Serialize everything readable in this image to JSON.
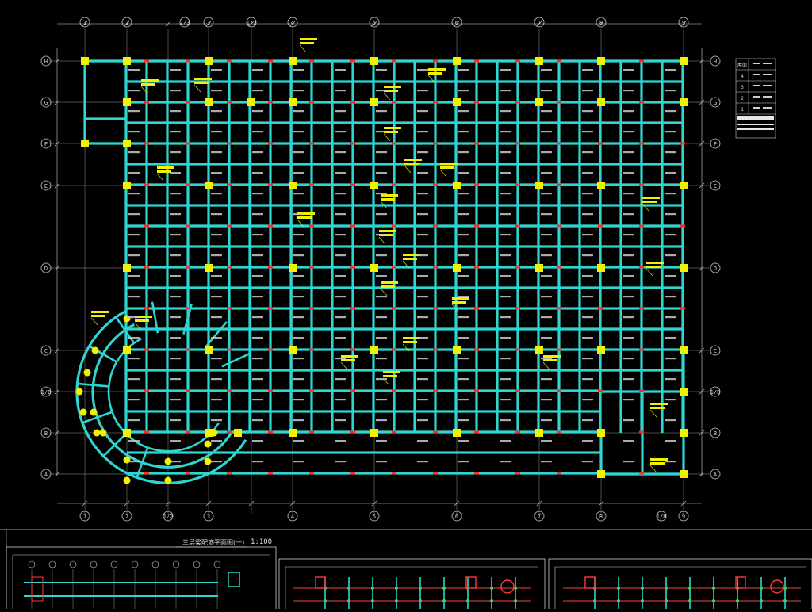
{
  "drawing": {
    "title": "三层梁配筋平面图(一)",
    "scale": "1:100",
    "colors": {
      "background": "#000000",
      "beam": "#2fd6d0",
      "column": "#f2f200",
      "axis_line": "#cfcfcf",
      "annotation": "#f2f200",
      "rebar_mark": "#ff2a2a",
      "text": "#d8d8d8"
    }
  },
  "axes": {
    "top_numbers": [
      "1",
      "2",
      "2/3",
      "3",
      "1/3",
      "4",
      "5",
      "6",
      "7",
      "8",
      "9"
    ],
    "bottom_numbers": [
      "1",
      "2",
      "1/2",
      "3",
      "4",
      "5",
      "6",
      "7",
      "8",
      "1/8",
      "9"
    ],
    "left_letters": [
      "H",
      "G",
      "F",
      "E",
      "D",
      "C",
      "1/B",
      "B",
      "A"
    ],
    "right_letters": [
      "H",
      "G",
      "F",
      "E",
      "D",
      "C",
      "1/B",
      "B",
      "A"
    ]
  },
  "legend": {
    "rows": [
      "屋面",
      "4",
      "3",
      "2",
      "1"
    ]
  },
  "sub_drawings": [
    {
      "name": "detail-left"
    },
    {
      "name": "detail-middle"
    },
    {
      "name": "detail-right"
    }
  ]
}
